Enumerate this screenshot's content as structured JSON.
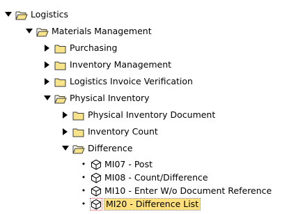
{
  "tree": {
    "logistics": "Logistics",
    "materials_management": "Materials Management",
    "purchasing": "Purchasing",
    "inventory_management": "Inventory Management",
    "logistics_invoice_verification": "Logistics Invoice Verification",
    "physical_inventory": "Physical Inventory",
    "physical_inventory_document": "Physical Inventory Document",
    "inventory_count": "Inventory Count",
    "difference": "Difference",
    "transactions": [
      "MI07 - Post",
      "MI08 - Count/Difference",
      "MI10 - Enter W/o Document Reference",
      "MI20 - Difference List"
    ],
    "selected_transaction": "MI20 - Difference List"
  },
  "colors": {
    "folder_fill": "#f7e38a",
    "folder_stroke": "#3d3d3d",
    "selection": "#ffe07a",
    "focus_outline": "#d9534f"
  },
  "icons": {
    "expanded": "triangle-down-icon",
    "collapsed": "triangle-right-icon",
    "folder_closed": "folder-icon",
    "folder_open": "folder-open-icon",
    "transaction": "transaction-cube-icon"
  }
}
